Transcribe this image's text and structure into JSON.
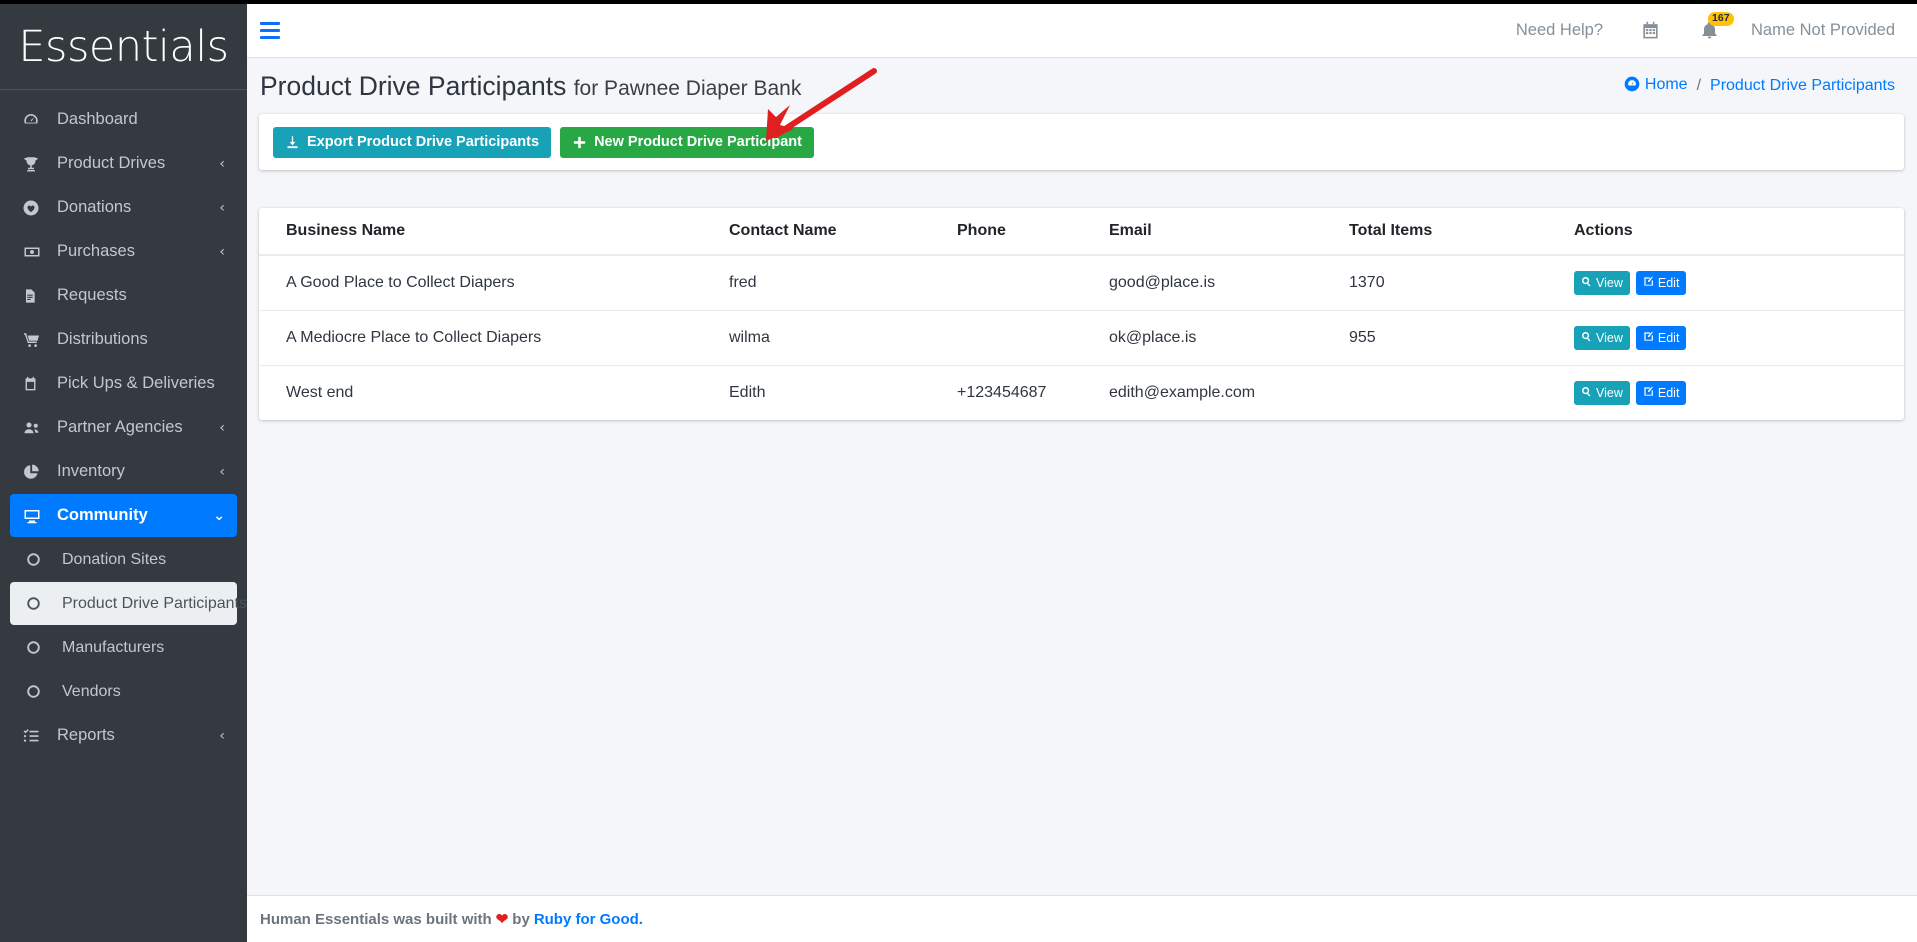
{
  "brand": {
    "name": "Essentials"
  },
  "sidebar": {
    "items": [
      {
        "label": "Dashboard",
        "icon": "dashboard-icon",
        "arrow": "",
        "state": "normal"
      },
      {
        "label": "Product Drives",
        "icon": "trophy-icon",
        "arrow": "‹",
        "state": "normal"
      },
      {
        "label": "Donations",
        "icon": "heart-circle-icon",
        "arrow": "‹",
        "state": "normal"
      },
      {
        "label": "Purchases",
        "icon": "money-icon",
        "arrow": "‹",
        "state": "normal"
      },
      {
        "label": "Requests",
        "icon": "document-icon",
        "arrow": "",
        "state": "normal"
      },
      {
        "label": "Distributions",
        "icon": "cart-icon",
        "arrow": "",
        "state": "normal"
      },
      {
        "label": "Pick Ups & Deliveries",
        "icon": "clipboard-icon",
        "arrow": "",
        "state": "normal"
      },
      {
        "label": "Partner Agencies",
        "icon": "users-icon",
        "arrow": "‹",
        "state": "normal"
      },
      {
        "label": "Inventory",
        "icon": "pie-chart-icon",
        "arrow": "‹",
        "state": "normal"
      },
      {
        "label": "Community",
        "icon": "desktop-icon",
        "arrow": "⌄",
        "state": "active-blue"
      },
      {
        "label": "Donation Sites",
        "icon": "circle-icon",
        "arrow": "",
        "state": "sub"
      },
      {
        "label": "Product Drive Participants",
        "icon": "circle-icon",
        "arrow": "",
        "state": "sub-active"
      },
      {
        "label": "Manufacturers",
        "icon": "circle-icon",
        "arrow": "",
        "state": "sub"
      },
      {
        "label": "Vendors",
        "icon": "circle-icon",
        "arrow": "",
        "state": "sub"
      },
      {
        "label": "Reports",
        "icon": "checklist-icon",
        "arrow": "‹",
        "state": "normal"
      }
    ]
  },
  "header": {
    "need_help": "Need Help?",
    "calendar_icon": "calendar-icon",
    "notification_icon": "bell-icon",
    "notification_count": "167",
    "username": "Name Not Provided",
    "menu_toggle_icon": "hamburger-icon"
  },
  "page": {
    "title": "Product Drive Participants",
    "title_suffix": "for Pawnee Diaper Bank",
    "breadcrumb": {
      "home": "Home",
      "separator": "/",
      "current": "Product Drive Participants",
      "home_icon": "dashboard-icon"
    }
  },
  "toolbar": {
    "export_label": "Export Product Drive Participants",
    "export_icon": "download-icon",
    "new_label": "New Product Drive Participant",
    "new_icon": "plus-icon"
  },
  "table": {
    "columns": [
      "Business Name",
      "Contact Name",
      "Phone",
      "Email",
      "Total Items",
      "Actions"
    ],
    "rows": [
      {
        "business_name": "A Good Place to Collect Diapers",
        "contact_name": "fred",
        "phone": "",
        "email": "good@place.is",
        "total_items": "1370",
        "view_label": "View",
        "edit_label": "Edit"
      },
      {
        "business_name": "A Mediocre Place to Collect Diapers",
        "contact_name": "wilma",
        "phone": "",
        "email": "ok@place.is",
        "total_items": "955",
        "view_label": "View",
        "edit_label": "Edit"
      },
      {
        "business_name": "West end",
        "contact_name": "Edith",
        "phone": "+123454687",
        "email": "edith@example.com",
        "total_items": "",
        "view_label": "View",
        "edit_label": "Edit"
      }
    ]
  },
  "footer": {
    "text_before": "Human Essentials was built with",
    "heart": "❤",
    "text_middle": "by",
    "link": "Ruby for Good."
  },
  "colors": {
    "sidebar_bg": "#343a40",
    "accent_blue": "#007bff",
    "teal": "#17a2b8",
    "green": "#28a745",
    "badge_yellow": "#ffc107",
    "annotation_red": "#e02020",
    "content_bg": "#f4f6f9"
  },
  "annotation": {
    "type": "arrow",
    "color": "#e02020",
    "points_to": "new-product-drive-participant-button"
  }
}
